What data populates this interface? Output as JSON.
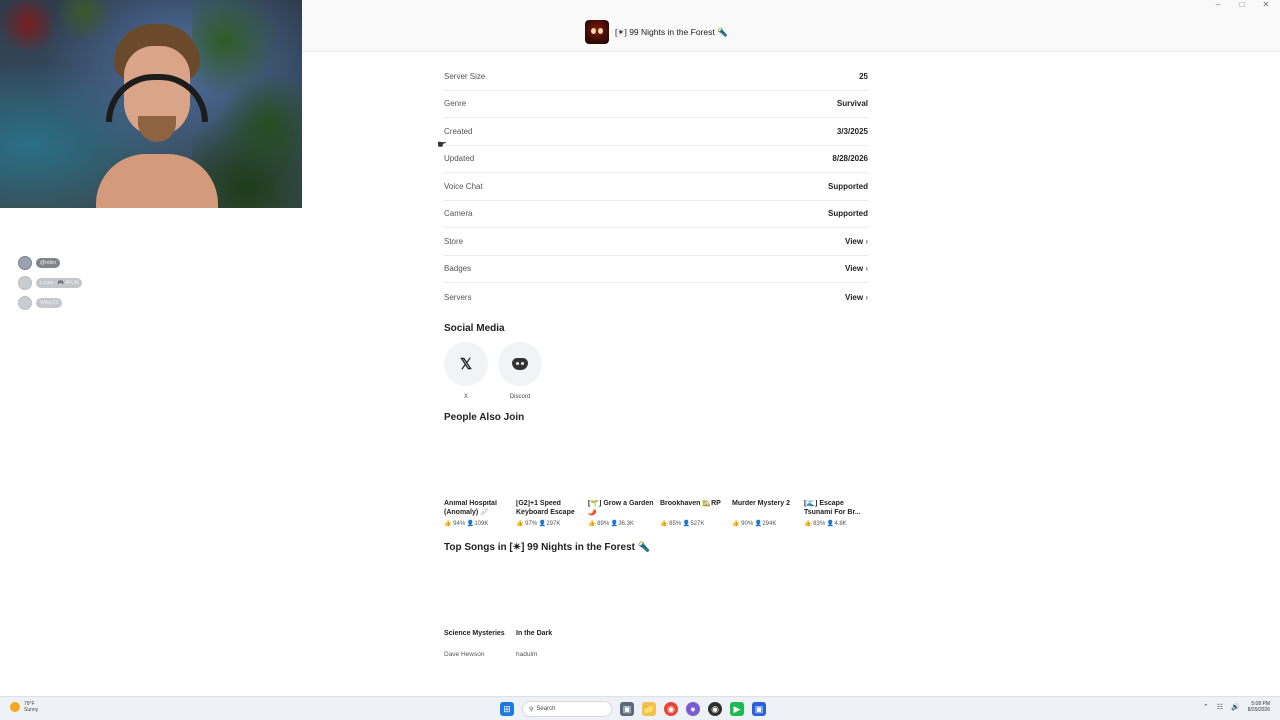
{
  "window": {
    "title": "[✴] 99 Nights in the Forest 🔦",
    "controls": [
      "–",
      "□",
      "✕"
    ]
  },
  "info_rows": [
    {
      "label": "Server Size",
      "value": "25",
      "link": false
    },
    {
      "label": "Genre",
      "value": "Survival",
      "link": false
    },
    {
      "label": "Created",
      "value": "3/3/2025",
      "link": false
    },
    {
      "label": "Updated",
      "value": "8/28/2026",
      "link": false
    },
    {
      "label": "Voice Chat",
      "value": "Supported",
      "link": false
    },
    {
      "label": "Camera",
      "value": "Supported",
      "link": false
    },
    {
      "label": "Store",
      "value": "View",
      "link": true
    },
    {
      "label": "Badges",
      "value": "View",
      "link": true
    },
    {
      "label": "Servers",
      "value": "View",
      "link": true
    }
  ],
  "social": {
    "title": "Social Media",
    "items": [
      {
        "label": "X",
        "icon": "x-logo-icon"
      },
      {
        "label": "Discord",
        "icon": "discord-icon"
      }
    ]
  },
  "people_also_join": {
    "title": "People Also Join",
    "games": [
      {
        "name": "Animal Hospital (Anomaly) 🩹",
        "rating": "94%",
        "players": "109K"
      },
      {
        "name": "[G2]+1 Speed Keyboard Escape",
        "rating": "97%",
        "players": "297K"
      },
      {
        "name": "[🌱] Grow a Garden 🌶️",
        "rating": "89%",
        "players": "36.3K"
      },
      {
        "name": "Brookhaven 🏡RP",
        "rating": "85%",
        "players": "527K"
      },
      {
        "name": "Murder Mystery 2",
        "rating": "90%",
        "players": "294K"
      },
      {
        "name": "[🌊] Escape Tsunami For Br...",
        "rating": "83%",
        "players": "4.8K"
      }
    ]
  },
  "top_songs": {
    "title": "Top Songs in [✴] 99 Nights in the Forest 🔦",
    "songs": [
      {
        "name": "Science Mysteries",
        "artist": "Dave Hewson"
      },
      {
        "name": "In the Dark",
        "artist": "hadulm"
      }
    ]
  },
  "overlay_users": [
    {
      "tag": "@rebin",
      "faded": false
    },
    {
      "tag": "Lucas · 🎮 4FUN",
      "faded": true
    },
    {
      "tag": "Wifey23",
      "faded": true
    }
  ],
  "taskbar": {
    "weather_temp": "79°F",
    "weather_desc": "Sunny",
    "search_placeholder": "Search",
    "time": "5:08 PM",
    "date": "8/29/2026"
  }
}
